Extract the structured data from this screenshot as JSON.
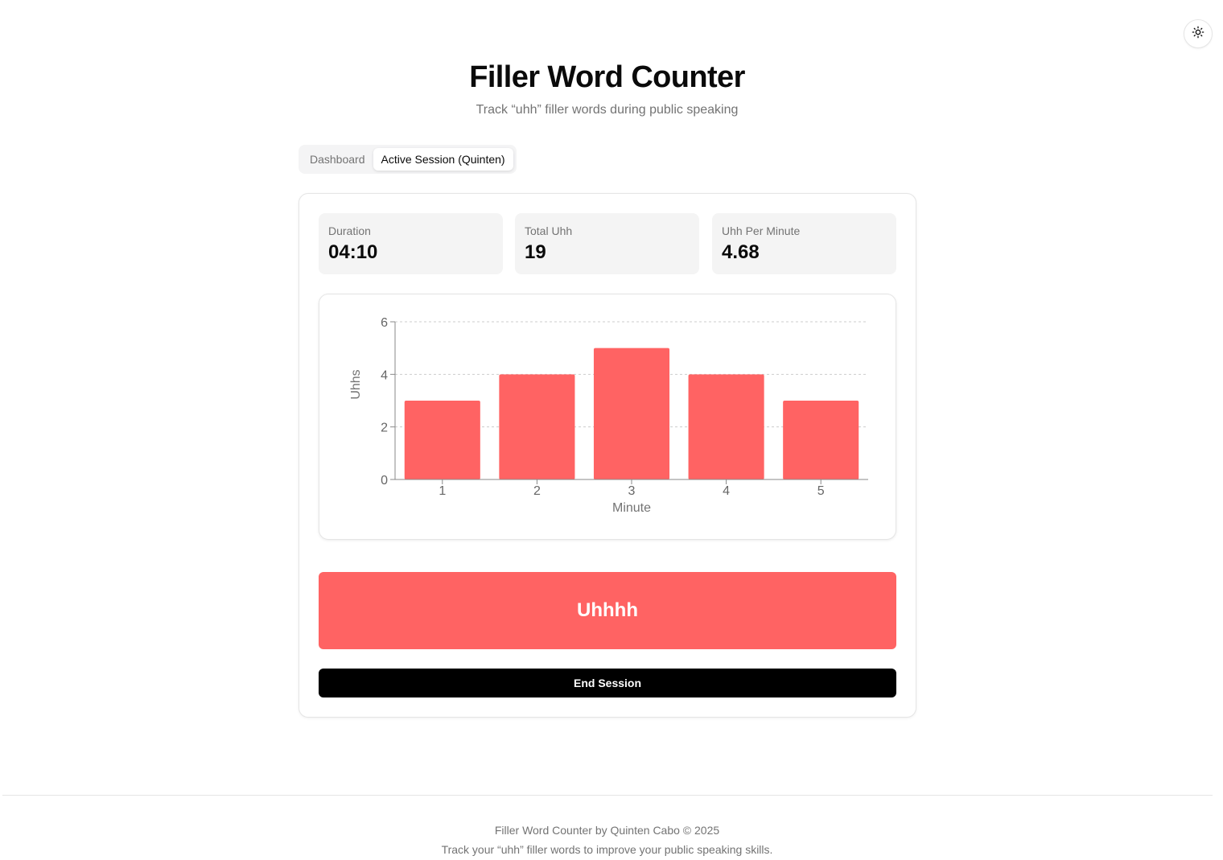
{
  "header": {
    "title": "Filler Word Counter",
    "subtitle": "Track “uhh” filler words during public speaking"
  },
  "theme_toggle": {
    "icon": "sun-icon"
  },
  "tabs": [
    {
      "label": "Dashboard",
      "active": false
    },
    {
      "label": "Active Session (Quinten)",
      "active": true
    }
  ],
  "stats": {
    "duration": {
      "label": "Duration",
      "value": "04:10"
    },
    "total": {
      "label": "Total Uhh",
      "value": "19"
    },
    "per_minute": {
      "label": "Uhh Per Minute",
      "value": "4.68"
    }
  },
  "chart_data": {
    "type": "bar",
    "categories": [
      "1",
      "2",
      "3",
      "4",
      "5"
    ],
    "values": [
      3,
      4,
      5,
      4,
      3
    ],
    "title": "",
    "xlabel": "Minute",
    "ylabel": "Uhhs",
    "ylim": [
      0,
      6
    ],
    "yticks": [
      "0",
      "2",
      "4",
      "6"
    ],
    "grid": true,
    "color": "#ff6363"
  },
  "actions": {
    "uhh_label": "Uhhhh",
    "end_label": "End Session"
  },
  "colors": {
    "accent": "#ff6363",
    "dark": "#000000"
  },
  "footer": {
    "line1": "Filler Word Counter by Quinten Cabo © 2025",
    "line2": "Track your “uhh” filler words to improve your public speaking skills."
  }
}
